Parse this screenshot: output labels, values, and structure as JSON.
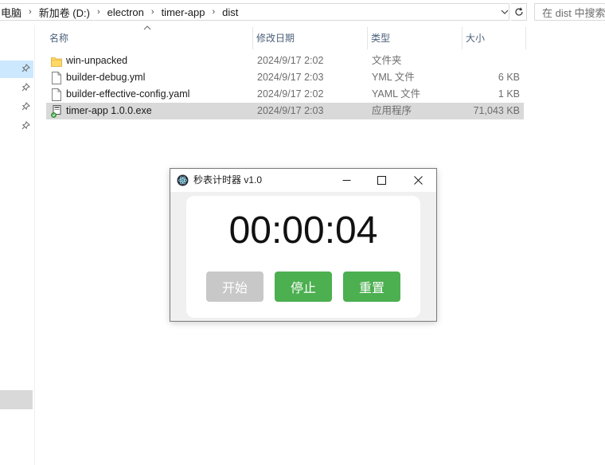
{
  "explorer": {
    "breadcrumb": [
      "电脑",
      "新加卷 (D:)",
      "electron",
      "timer-app",
      "dist"
    ],
    "search_placeholder": "在 dist 中搜索",
    "columns": {
      "name": "名称",
      "date": "修改日期",
      "type": "类型",
      "size": "大小"
    },
    "files": [
      {
        "name": "win-unpacked",
        "date": "2024/9/17 2:02",
        "type": "文件夹",
        "size": "",
        "icon": "folder-icon",
        "selected": false
      },
      {
        "name": "builder-debug.yml",
        "date": "2024/9/17 2:03",
        "type": "YML 文件",
        "size": "6 KB",
        "icon": "file-icon",
        "selected": false
      },
      {
        "name": "builder-effective-config.yaml",
        "date": "2024/9/17 2:02",
        "type": "YAML 文件",
        "size": "1 KB",
        "icon": "file-icon",
        "selected": false
      },
      {
        "name": "timer-app 1.0.0.exe",
        "date": "2024/9/17 2:03",
        "type": "应用程序",
        "size": "71,043 KB",
        "icon": "exe-icon",
        "selected": true
      }
    ]
  },
  "stopwatch": {
    "title": "秒表计时器 v1.0",
    "time": "00:00:04",
    "buttons": {
      "start": "开始",
      "stop": "停止",
      "reset": "重置"
    },
    "colors": {
      "active_button": "#4caf50",
      "disabled_button": "#c8c8c8"
    }
  }
}
